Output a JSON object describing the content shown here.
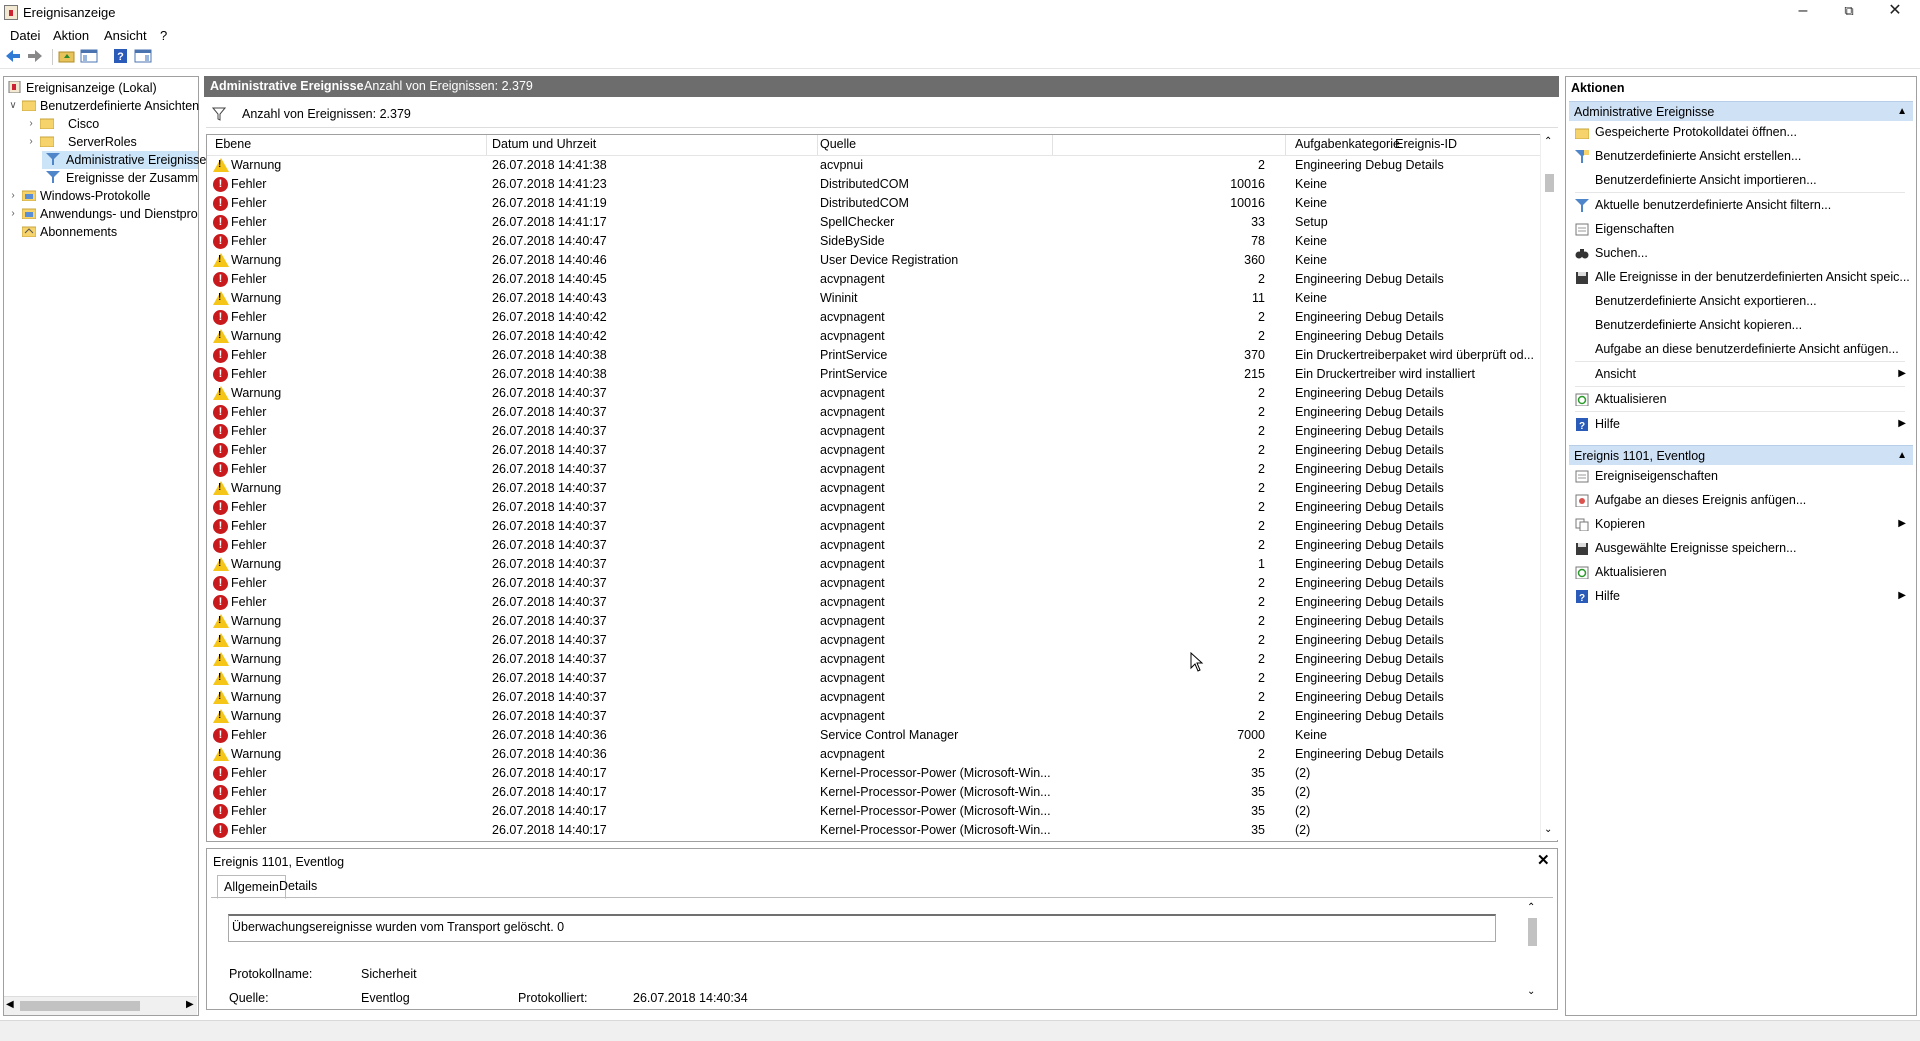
{
  "window": {
    "title": "Ereignisanzeige"
  },
  "menu": [
    "Datei",
    "Aktion",
    "Ansicht",
    "?"
  ],
  "tree": {
    "root": "Ereignisanzeige (Lokal)",
    "custom_views": "Benutzerdefinierte Ansichten",
    "cisco": "Cisco",
    "serverroles": "ServerRoles",
    "admin_events": "Administrative Ereignisse",
    "summary_events": "Ereignisse der Zusammen",
    "windows_logs": "Windows-Protokolle",
    "app_services": "Anwendungs- und Dienstpro",
    "subscriptions": "Abonnements"
  },
  "center": {
    "header_title": "Administrative Ereignisse",
    "header_count": "Anzahl von Ereignissen: 2.379",
    "filter_text": "Anzahl von Ereignissen: 2.379",
    "columns": [
      "Ebene",
      "Datum und Uhrzeit",
      "Quelle",
      "Ereignis-ID",
      "Aufgabenkategorie"
    ],
    "rows": [
      [
        "warn",
        "Warnung",
        "26.07.2018 14:41:38",
        "acvpnui",
        "2",
        "Engineering Debug Details"
      ],
      [
        "err",
        "Fehler",
        "26.07.2018 14:41:23",
        "DistributedCOM",
        "10016",
        "Keine"
      ],
      [
        "err",
        "Fehler",
        "26.07.2018 14:41:19",
        "DistributedCOM",
        "10016",
        "Keine"
      ],
      [
        "err",
        "Fehler",
        "26.07.2018 14:41:17",
        "SpellChecker",
        "33",
        "Setup"
      ],
      [
        "err",
        "Fehler",
        "26.07.2018 14:40:47",
        "SideBySide",
        "78",
        "Keine"
      ],
      [
        "warn",
        "Warnung",
        "26.07.2018 14:40:46",
        "User Device Registration",
        "360",
        "Keine"
      ],
      [
        "err",
        "Fehler",
        "26.07.2018 14:40:45",
        "acvpnagent",
        "2",
        "Engineering Debug Details"
      ],
      [
        "warn",
        "Warnung",
        "26.07.2018 14:40:43",
        "Wininit",
        "11",
        "Keine"
      ],
      [
        "err",
        "Fehler",
        "26.07.2018 14:40:42",
        "acvpnagent",
        "2",
        "Engineering Debug Details"
      ],
      [
        "warn",
        "Warnung",
        "26.07.2018 14:40:42",
        "acvpnagent",
        "2",
        "Engineering Debug Details"
      ],
      [
        "err",
        "Fehler",
        "26.07.2018 14:40:38",
        "PrintService",
        "370",
        "Ein Druckertreiberpaket wird überprüft od..."
      ],
      [
        "err",
        "Fehler",
        "26.07.2018 14:40:38",
        "PrintService",
        "215",
        "Ein Druckertreiber wird installiert"
      ],
      [
        "warn",
        "Warnung",
        "26.07.2018 14:40:37",
        "acvpnagent",
        "2",
        "Engineering Debug Details"
      ],
      [
        "err",
        "Fehler",
        "26.07.2018 14:40:37",
        "acvpnagent",
        "2",
        "Engineering Debug Details"
      ],
      [
        "err",
        "Fehler",
        "26.07.2018 14:40:37",
        "acvpnagent",
        "2",
        "Engineering Debug Details"
      ],
      [
        "err",
        "Fehler",
        "26.07.2018 14:40:37",
        "acvpnagent",
        "2",
        "Engineering Debug Details"
      ],
      [
        "err",
        "Fehler",
        "26.07.2018 14:40:37",
        "acvpnagent",
        "2",
        "Engineering Debug Details"
      ],
      [
        "warn",
        "Warnung",
        "26.07.2018 14:40:37",
        "acvpnagent",
        "2",
        "Engineering Debug Details"
      ],
      [
        "err",
        "Fehler",
        "26.07.2018 14:40:37",
        "acvpnagent",
        "2",
        "Engineering Debug Details"
      ],
      [
        "err",
        "Fehler",
        "26.07.2018 14:40:37",
        "acvpnagent",
        "2",
        "Engineering Debug Details"
      ],
      [
        "err",
        "Fehler",
        "26.07.2018 14:40:37",
        "acvpnagent",
        "2",
        "Engineering Debug Details"
      ],
      [
        "warn",
        "Warnung",
        "26.07.2018 14:40:37",
        "acvpnagent",
        "1",
        "Engineering Debug Details"
      ],
      [
        "err",
        "Fehler",
        "26.07.2018 14:40:37",
        "acvpnagent",
        "2",
        "Engineering Debug Details"
      ],
      [
        "err",
        "Fehler",
        "26.07.2018 14:40:37",
        "acvpnagent",
        "2",
        "Engineering Debug Details"
      ],
      [
        "warn",
        "Warnung",
        "26.07.2018 14:40:37",
        "acvpnagent",
        "2",
        "Engineering Debug Details"
      ],
      [
        "warn",
        "Warnung",
        "26.07.2018 14:40:37",
        "acvpnagent",
        "2",
        "Engineering Debug Details"
      ],
      [
        "warn",
        "Warnung",
        "26.07.2018 14:40:37",
        "acvpnagent",
        "2",
        "Engineering Debug Details"
      ],
      [
        "warn",
        "Warnung",
        "26.07.2018 14:40:37",
        "acvpnagent",
        "2",
        "Engineering Debug Details"
      ],
      [
        "warn",
        "Warnung",
        "26.07.2018 14:40:37",
        "acvpnagent",
        "2",
        "Engineering Debug Details"
      ],
      [
        "warn",
        "Warnung",
        "26.07.2018 14:40:37",
        "acvpnagent",
        "2",
        "Engineering Debug Details"
      ],
      [
        "err",
        "Fehler",
        "26.07.2018 14:40:36",
        "Service Control Manager",
        "7000",
        "Keine"
      ],
      [
        "warn",
        "Warnung",
        "26.07.2018 14:40:36",
        "acvpnagent",
        "2",
        "Engineering Debug Details"
      ],
      [
        "err",
        "Fehler",
        "26.07.2018 14:40:17",
        "Kernel-Processor-Power (Microsoft-Win...",
        "35",
        "(2)"
      ],
      [
        "err",
        "Fehler",
        "26.07.2018 14:40:17",
        "Kernel-Processor-Power (Microsoft-Win...",
        "35",
        "(2)"
      ],
      [
        "err",
        "Fehler",
        "26.07.2018 14:40:17",
        "Kernel-Processor-Power (Microsoft-Win...",
        "35",
        "(2)"
      ],
      [
        "err",
        "Fehler",
        "26.07.2018 14:40:17",
        "Kernel-Processor-Power (Microsoft-Win...",
        "35",
        "(2)"
      ]
    ]
  },
  "detail": {
    "title": "Ereignis 1101, Eventlog",
    "tabs": [
      "Allgemein",
      "Details"
    ],
    "message": "Überwachungsereignisse wurden vom Transport gelöscht. 0",
    "logname_label": "Protokollname:",
    "logname_value": "Sicherheit",
    "source_label": "Quelle:",
    "source_value": "Eventlog",
    "logged_label": "Protokolliert:",
    "logged_value": "26.07.2018 14:40:34"
  },
  "actions": {
    "title": "Aktionen",
    "section1": "Administrative Ereignisse",
    "items1": [
      {
        "label": "Gespeicherte Protokolldatei öffnen...",
        "icon": "open-folder-icon",
        "arrow": false
      },
      {
        "label": "Benutzerdefinierte Ansicht erstellen...",
        "icon": "filter-create-icon",
        "arrow": false
      },
      {
        "label": "Benutzerdefinierte Ansicht importieren...",
        "icon": "",
        "arrow": false
      },
      {
        "label": "Aktuelle benutzerdefinierte Ansicht filtern...",
        "icon": "filter-icon",
        "arrow": false
      },
      {
        "label": "Eigenschaften",
        "icon": "properties-icon",
        "arrow": false
      },
      {
        "label": "Suchen...",
        "icon": "binoculars-icon",
        "arrow": false
      },
      {
        "label": "Alle Ereignisse in der benutzerdefinierten Ansicht speic...",
        "icon": "save-icon",
        "arrow": false
      },
      {
        "label": "Benutzerdefinierte Ansicht exportieren...",
        "icon": "",
        "arrow": false
      },
      {
        "label": "Benutzerdefinierte Ansicht kopieren...",
        "icon": "",
        "arrow": false
      },
      {
        "label": "Aufgabe an diese benutzerdefinierte Ansicht anfügen...",
        "icon": "",
        "arrow": false
      },
      {
        "label": "Ansicht",
        "icon": "",
        "arrow": true
      },
      {
        "label": "Aktualisieren",
        "icon": "refresh-icon",
        "arrow": false
      },
      {
        "label": "Hilfe",
        "icon": "help-icon",
        "arrow": true
      }
    ],
    "section2": "Ereignis 1101, Eventlog",
    "items2": [
      {
        "label": "Ereigniseigenschaften",
        "icon": "properties-icon",
        "arrow": false
      },
      {
        "label": "Aufgabe an dieses Ereignis anfügen...",
        "icon": "task-icon",
        "arrow": false
      },
      {
        "label": "Kopieren",
        "icon": "copy-icon",
        "arrow": true
      },
      {
        "label": "Ausgewählte Ereignisse speichern...",
        "icon": "save-icon",
        "arrow": false
      },
      {
        "label": "Aktualisieren",
        "icon": "refresh-icon",
        "arrow": false
      },
      {
        "label": "Hilfe",
        "icon": "help-icon",
        "arrow": true
      }
    ]
  },
  "colors": {
    "error": "#c8191d",
    "warning": "#f5c518",
    "section_header": "#cfe1f5",
    "center_header": "#6d6d6d"
  }
}
